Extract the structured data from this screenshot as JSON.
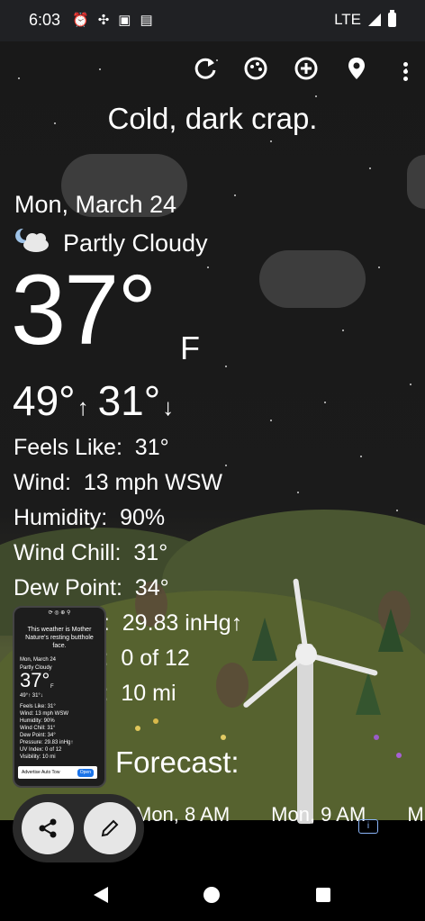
{
  "status_bar": {
    "time": "6:03",
    "network": "LTE",
    "icons": [
      "alarm-icon",
      "fan-icon",
      "sim-card-icon",
      "calendar-icon",
      "signal-icon",
      "battery-icon"
    ]
  },
  "toolbar": {
    "icons": [
      "refresh-icon",
      "theme-icon",
      "add-location-icon",
      "location-pin-icon",
      "overflow-menu-icon"
    ]
  },
  "headline": "Cold, dark crap.",
  "current": {
    "date": "Mon, March 24",
    "condition": "Partly Cloudy",
    "condition_icon": "night-partly-cloudy-icon",
    "temperature": "37°",
    "unit": "F",
    "high": "49°",
    "low": "31°",
    "high_arrow": "↑",
    "low_arrow": "↓"
  },
  "details": [
    {
      "label": "Feels Like:",
      "value": "31°"
    },
    {
      "label": "Wind:",
      "value": "13 mph WSW"
    },
    {
      "label": "Humidity:",
      "value": "90%"
    },
    {
      "label": "Wind Chill:",
      "value": "31°"
    },
    {
      "label": "Dew Point:",
      "value": "34°"
    },
    {
      "label": "e:",
      "value": "29.83 inHg↑"
    },
    {
      "label": "x:",
      "value": "0 of 12"
    },
    {
      "label": "y:",
      "value": "10 mi"
    }
  ],
  "forecast": {
    "title": "Forecast:",
    "hours": [
      "Mon, 8 AM",
      "Mon, 9 AM",
      "M"
    ]
  },
  "pip_preview": {
    "headline": "This weather is Mother Nature's resting butthole face.",
    "date": "Mon, March 24",
    "condition": "Partly Cloudy",
    "temperature": "37°",
    "unit": "F",
    "hilo": "49°↑ 31°↓",
    "lines": [
      "Feels Like: 31°",
      "Wind: 13 mph WSW",
      "Humidity: 90%",
      "Wind Chill: 31°",
      "Dew Point: 34°",
      "Pressure: 29.83 inHg↑",
      "UV Index: 0 of 12",
      "Visibility: 10 mi"
    ],
    "ad_text": "Advertise Auto Tow",
    "ad_button": "Open"
  },
  "fab": {
    "share_icon": "share-icon",
    "edit_icon": "pencil-icon"
  },
  "ad_badge": "i",
  "nav": [
    "back-icon",
    "home-icon",
    "recents-icon"
  ],
  "colors": {
    "sky": "#1b1b1b",
    "grass": "#4d5a30",
    "cloud": "#3f3f3f",
    "status_bar": "#202124",
    "fab": "#e6e6e6"
  }
}
